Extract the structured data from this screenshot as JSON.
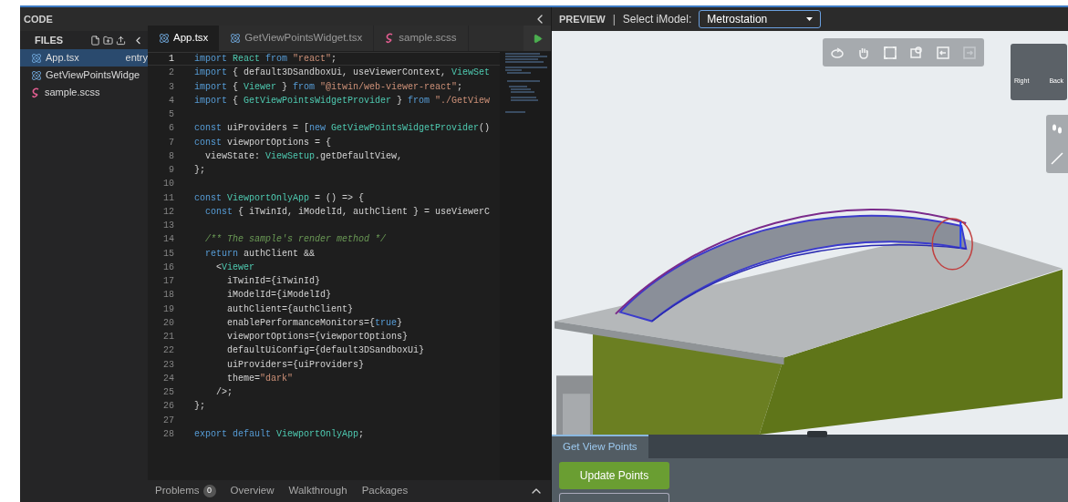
{
  "code_panel": {
    "title": "CODE",
    "files": {
      "title": "FILES",
      "items": [
        {
          "name": "App.tsx",
          "kind": "react",
          "badge": "entry",
          "selected": true
        },
        {
          "name": "GetViewPointsWidge",
          "kind": "react",
          "selected": false
        },
        {
          "name": "sample.scss",
          "kind": "sass",
          "selected": false
        }
      ]
    },
    "tabs": [
      {
        "label": "App.tsx",
        "kind": "react",
        "selected": true
      },
      {
        "label": "GetViewPointsWidget.tsx",
        "kind": "react",
        "selected": false
      },
      {
        "label": "sample.scss",
        "kind": "sass",
        "selected": false
      }
    ],
    "lines": [
      {
        "n": "1",
        "current": true,
        "tokens": [
          {
            "kind": "kw",
            "text": "import"
          },
          {
            "kind": "type",
            "text": " React"
          },
          {
            "kind": "kw",
            "text": " from"
          },
          {
            "kind": "str",
            "text": " \"react\""
          },
          {
            "kind": "plain",
            "text": ";"
          }
        ]
      },
      {
        "n": "2",
        "current": false,
        "tokens": [
          {
            "kind": "kw",
            "text": "import"
          },
          {
            "kind": "plain",
            "text": " { default3DSandboxUi, useViewerContext,"
          },
          {
            "kind": "type",
            "text": " ViewSet"
          }
        ]
      },
      {
        "n": "3",
        "current": false,
        "tokens": [
          {
            "kind": "kw",
            "text": "import"
          },
          {
            "kind": "plain",
            "text": " {"
          },
          {
            "kind": "type",
            "text": " Viewer"
          },
          {
            "kind": "plain",
            "text": " }"
          },
          {
            "kind": "kw",
            "text": " from"
          },
          {
            "kind": "str",
            "text": " \"@itwin/web-viewer-react\""
          },
          {
            "kind": "plain",
            "text": ";"
          }
        ]
      },
      {
        "n": "4",
        "current": false,
        "tokens": [
          {
            "kind": "kw",
            "text": "import"
          },
          {
            "kind": "plain",
            "text": " {"
          },
          {
            "kind": "type",
            "text": " GetViewPointsWidgetProvider"
          },
          {
            "kind": "plain",
            "text": " }"
          },
          {
            "kind": "kw",
            "text": " from"
          },
          {
            "kind": "str",
            "text": " \"./GetView"
          }
        ]
      },
      {
        "n": "5",
        "current": false
      },
      {
        "n": "6",
        "current": false,
        "tokens": [
          {
            "kind": "kw",
            "text": "const"
          },
          {
            "kind": "plain",
            "text": " uiProviders = ["
          },
          {
            "kind": "kw",
            "text": "new"
          },
          {
            "kind": "type",
            "text": " GetViewPointsWidgetProvider"
          },
          {
            "kind": "plain",
            "text": "()"
          }
        ]
      },
      {
        "n": "7",
        "current": false,
        "tokens": [
          {
            "kind": "kw",
            "text": "const"
          },
          {
            "kind": "plain",
            "text": " viewportOptions = {"
          }
        ]
      },
      {
        "n": "8",
        "current": false,
        "tokens": [
          {
            "kind": "plain",
            "text": "  viewState:"
          },
          {
            "kind": "type",
            "text": " ViewSetup"
          },
          {
            "kind": "plain",
            "text": ".getDefaultView,"
          }
        ]
      },
      {
        "n": "9",
        "current": false,
        "tokens": [
          {
            "kind": "plain",
            "text": "};"
          }
        ]
      },
      {
        "n": "10",
        "current": false
      },
      {
        "n": "11",
        "current": false,
        "tokens": [
          {
            "kind": "kw",
            "text": "const"
          },
          {
            "kind": "type",
            "text": " ViewportOnlyApp"
          },
          {
            "kind": "plain",
            "text": " = () => {"
          }
        ]
      },
      {
        "n": "12",
        "current": false,
        "tokens": [
          {
            "kind": "kw",
            "text": "  const"
          },
          {
            "kind": "plain",
            "text": " { iTwinId, iModelId, authClient } = useViewerC"
          }
        ]
      },
      {
        "n": "13",
        "current": false
      },
      {
        "n": "14",
        "current": false,
        "tokens": [
          {
            "kind": "comment",
            "text": "  /** The sample's render method */"
          }
        ]
      },
      {
        "n": "15",
        "current": false,
        "tokens": [
          {
            "kind": "kw",
            "text": "  return"
          },
          {
            "kind": "plain",
            "text": " authClient &&"
          }
        ]
      },
      {
        "n": "16",
        "current": false,
        "tokens": [
          {
            "kind": "plain",
            "text": "    <"
          },
          {
            "kind": "type",
            "text": "Viewer"
          }
        ]
      },
      {
        "n": "17",
        "current": false,
        "tokens": [
          {
            "kind": "plain",
            "text": "      iTwinId={iTwinId}"
          }
        ]
      },
      {
        "n": "18",
        "current": false,
        "tokens": [
          {
            "kind": "plain",
            "text": "      iModelId={iModelId}"
          }
        ]
      },
      {
        "n": "19",
        "current": false,
        "tokens": [
          {
            "kind": "plain",
            "text": "      authClient={authClient}"
          }
        ]
      },
      {
        "n": "20",
        "current": false,
        "tokens": [
          {
            "kind": "plain",
            "text": "      enablePerformanceMonitors={"
          },
          {
            "kind": "kw",
            "text": "true"
          },
          {
            "kind": "plain",
            "text": "}"
          }
        ]
      },
      {
        "n": "21",
        "current": false,
        "tokens": [
          {
            "kind": "plain",
            "text": "      viewportOptions={viewportOptions}"
          }
        ]
      },
      {
        "n": "22",
        "current": false,
        "tokens": [
          {
            "kind": "plain",
            "text": "      defaultUiConfig={default3DSandboxUi}"
          }
        ]
      },
      {
        "n": "23",
        "current": false,
        "tokens": [
          {
            "kind": "plain",
            "text": "      uiProviders={uiProviders}"
          }
        ]
      },
      {
        "n": "24",
        "current": false,
        "tokens": [
          {
            "kind": "plain",
            "text": "      theme="
          },
          {
            "kind": "str",
            "text": "\"dark\""
          }
        ]
      },
      {
        "n": "25",
        "current": false,
        "tokens": [
          {
            "kind": "plain",
            "text": "    />;"
          }
        ]
      },
      {
        "n": "26",
        "current": false,
        "tokens": [
          {
            "kind": "plain",
            "text": "};"
          }
        ]
      },
      {
        "n": "27",
        "current": false
      },
      {
        "n": "28",
        "current": false,
        "tokens": [
          {
            "kind": "kw",
            "text": "export"
          },
          {
            "kind": "kw",
            "text": " default"
          },
          {
            "kind": "type",
            "text": " ViewportOnlyApp"
          },
          {
            "kind": "plain",
            "text": ";"
          }
        ]
      }
    ],
    "bottom_tabs": [
      {
        "label": "Problems",
        "count": "0"
      },
      {
        "label": "Overview"
      },
      {
        "label": "Walkthrough"
      },
      {
        "label": "Packages"
      }
    ]
  },
  "preview": {
    "title": "PREVIEW",
    "separator": "|",
    "select_label": "Select iModel:",
    "select_value": "Metrostation",
    "toolbar": [
      {
        "kind": "rotate",
        "disabled": false
      },
      {
        "kind": "pan",
        "disabled": false
      },
      {
        "kind": "fit",
        "disabled": false
      },
      {
        "kind": "zoom",
        "disabled": false
      },
      {
        "kind": "back",
        "disabled": false
      },
      {
        "kind": "forward",
        "disabled": true
      }
    ],
    "cube": {
      "faces": [
        "Right",
        "Back"
      ]
    },
    "widget": {
      "tabs": [
        {
          "label": "Get View Points",
          "selected": true
        }
      ],
      "button": "Update Points"
    }
  }
}
